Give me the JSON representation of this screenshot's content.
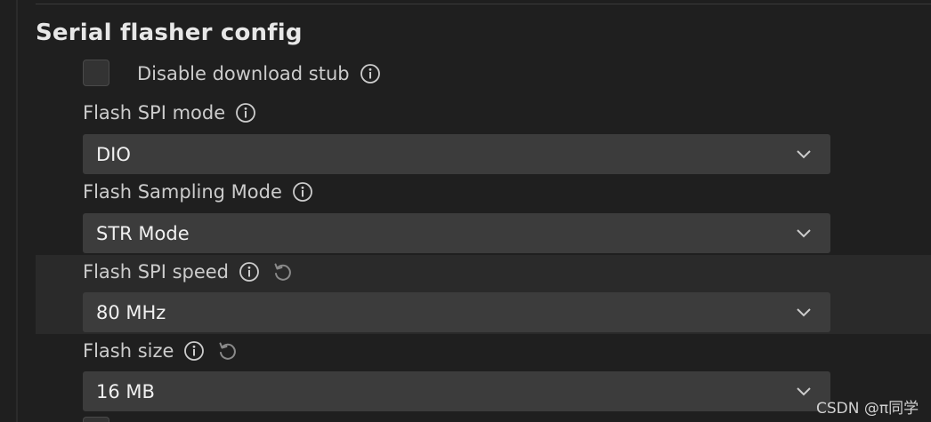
{
  "section": {
    "title": "Serial flasher config"
  },
  "settings": {
    "disable_download_stub": {
      "label": "Disable download stub",
      "checked": false
    },
    "flash_spi_mode": {
      "label": "Flash SPI mode",
      "value": "DIO"
    },
    "flash_sampling_mode": {
      "label": "Flash Sampling Mode",
      "value": "STR Mode"
    },
    "flash_spi_speed": {
      "label": "Flash SPI speed",
      "value": "80 MHz"
    },
    "flash_size": {
      "label": "Flash size",
      "value": "16 MB"
    }
  },
  "watermark": "CSDN @π同学",
  "icons": {
    "info": "info-icon",
    "reset": "reset-icon",
    "chevron": "chevron-down-icon"
  },
  "colors": {
    "background": "#1f1f1f",
    "hover_row": "#2a2a2a",
    "dropdown": "#3c3c3c",
    "label_text": "#cccccc",
    "value_text": "#f0f0f0"
  }
}
